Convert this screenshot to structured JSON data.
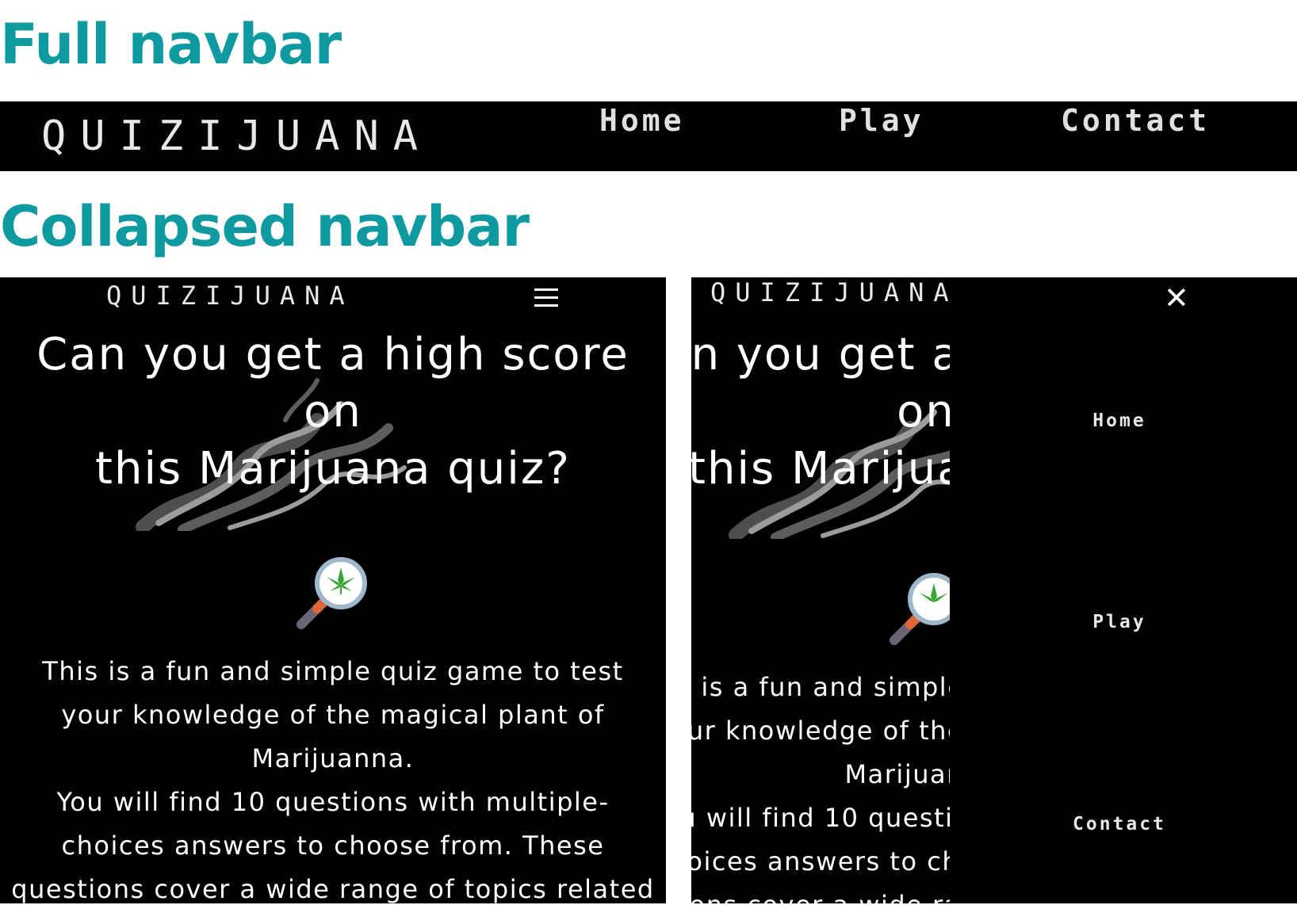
{
  "headings": {
    "full": "Full navbar",
    "collapsed": "Collapsed navbar"
  },
  "full_navbar": {
    "brand": "QUIZIJUANA",
    "links": [
      "Home",
      "Play",
      "Contact"
    ]
  },
  "collapsed_navbar": {
    "brand": "QUIZIJUANA",
    "menu_icon": "hamburger-icon",
    "close_icon": "close-icon"
  },
  "hero": {
    "title_line1": "Can you get a high score on",
    "title_line2": "this Marijuana quiz?"
  },
  "intro": {
    "line1": "This is a fun and simple quiz game to test",
    "line2": "your knowledge of the magical plant of",
    "line3": "Marijuanna.",
    "line4": "You will find 10 questions with multiple-",
    "line5": "choices answers to choose from. These",
    "line6": "questions cover a wide range of topics related"
  },
  "open_menu": {
    "links": [
      "Home",
      "Play",
      "Contact"
    ]
  },
  "colors": {
    "heading": "#0e9aa0",
    "nav_background": "#000000",
    "leaf": "#3aa335",
    "lens_ring": "#9fb7c9"
  }
}
